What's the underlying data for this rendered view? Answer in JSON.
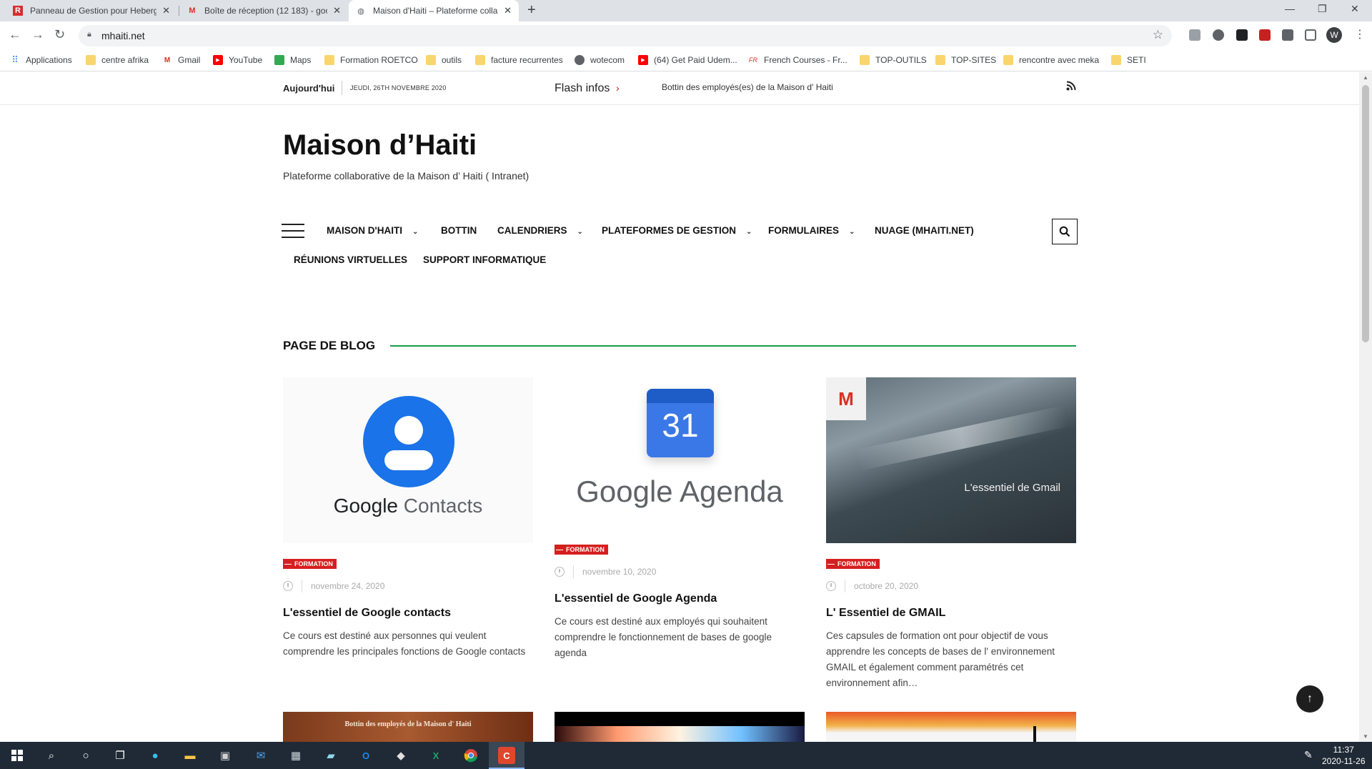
{
  "browser": {
    "tabs": [
      {
        "title": "Panneau de Gestion pour Heberg",
        "icon": "r-logo-icon"
      },
      {
        "title": "Boîte de réception (12 183) - goo",
        "icon": "gmail-icon"
      },
      {
        "title": "Maison d'Haiti – Plateforme colla",
        "icon": "globe-icon",
        "active": true
      }
    ],
    "url": "mhaiti.net",
    "profile_initial": "W",
    "bookmarks": [
      {
        "label": "Applications",
        "icon": "apps-grid-icon"
      },
      {
        "label": "centre afrika",
        "icon": "folder-icon"
      },
      {
        "label": "Gmail",
        "icon": "gmail-icon"
      },
      {
        "label": "YouTube",
        "icon": "youtube-icon"
      },
      {
        "label": "Maps",
        "icon": "maps-icon"
      },
      {
        "label": "Formation ROETCO",
        "icon": "folder-icon"
      },
      {
        "label": "outils",
        "icon": "folder-icon"
      },
      {
        "label": "facture recurrentes",
        "icon": "folder-icon"
      },
      {
        "label": "wotecom",
        "icon": "globe-icon"
      },
      {
        "label": "(64) Get Paid Udem...",
        "icon": "youtube-icon"
      },
      {
        "label": "French Courses - Fr...",
        "icon": "french-courses-icon"
      },
      {
        "label": "TOP-OUTILS",
        "icon": "folder-icon"
      },
      {
        "label": "TOP-SITES",
        "icon": "folder-icon"
      },
      {
        "label": "rencontre avec meka",
        "icon": "folder-icon"
      },
      {
        "label": "SETI",
        "icon": "folder-icon"
      }
    ]
  },
  "site": {
    "today_label": "Aujourd'hui",
    "date": "JEUDI, 26TH NOVEMBRE 2020",
    "flash_label": "Flash infos",
    "ticker": "Bottin des employés(es) de la Maison d' Haiti",
    "title": "Maison d’Haiti",
    "tagline": "Plateforme collaborative de la Maison d’ Haiti ( Intranet)"
  },
  "menu": [
    {
      "label": "MAISON D'HAITI",
      "dropdown": true
    },
    {
      "label": "BOTTIN",
      "dropdown": false
    },
    {
      "label": "CALENDRIERS",
      "dropdown": true
    },
    {
      "label": "PLATEFORMES DE GESTION",
      "dropdown": true
    },
    {
      "label": "FORMULAIRES",
      "dropdown": true
    },
    {
      "label": "NUAGE (MHAITI.NET)",
      "dropdown": false
    },
    {
      "label": "RÉUNIONS VIRTUELLES",
      "dropdown": false
    },
    {
      "label": "SUPPORT INFORMATIQUE",
      "dropdown": false
    }
  ],
  "blog": {
    "section_title": "PAGE DE BLOG",
    "posts": [
      {
        "category": "FORMATION",
        "date": "novembre 24, 2020",
        "title": "L'essentiel de Google contacts",
        "excerpt": "Ce cours est destiné aux personnes qui veulent comprendre les principales fonctions de Google contacts",
        "image_text": [
          "Google",
          "Contacts"
        ]
      },
      {
        "category": "FORMATION",
        "date": "novembre 10, 2020",
        "title": "L'essentiel de Google Agenda",
        "excerpt": "Ce cours est destiné aux employés qui souhaitent comprendre le fonctionnement de bases de google agenda",
        "image_text": [
          "31",
          "Google Agenda"
        ]
      },
      {
        "category": "FORMATION",
        "date": "octobre 20, 2020",
        "title": "L' Essentiel de GMAIL",
        "excerpt": "Ces capsules de formation ont pour objectif de vous apprendre les concepts de bases de l' environnement GMAIL et également comment paramétrés cet environnement afin…",
        "image_text": [
          "L'essentiel de Gmail"
        ]
      }
    ],
    "next_row_image_text": "Bottin des employés de la Maison d' Haiti"
  },
  "taskbar": {
    "time": "11:37",
    "date": "2020-11-26"
  },
  "colors": {
    "accent_red": "#d61f1f",
    "accent_green": "#1a9b4b",
    "google_blue": "#1a73e8"
  }
}
